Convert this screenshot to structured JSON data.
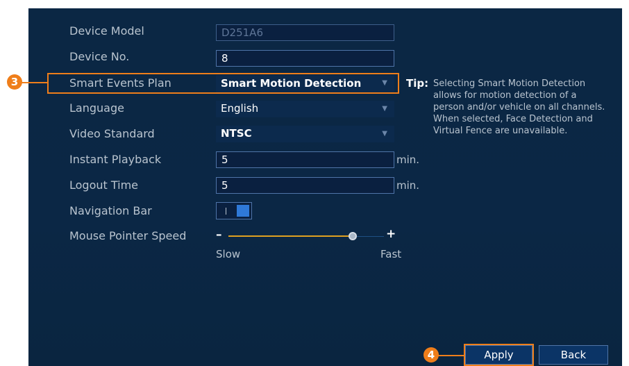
{
  "settings": {
    "device_model": {
      "label": "Device Model",
      "value": "D251A6"
    },
    "device_no": {
      "label": "Device No.",
      "value": "8"
    },
    "smart_events_plan": {
      "label": "Smart Events Plan",
      "value": "Smart Motion Detection"
    },
    "language": {
      "label": "Language",
      "value": "English"
    },
    "video_standard": {
      "label": "Video Standard",
      "value": "NTSC"
    },
    "instant_playback": {
      "label": "Instant Playback",
      "value": "5",
      "unit": "min."
    },
    "logout_time": {
      "label": "Logout Time",
      "value": "5",
      "unit": "min."
    },
    "navigation_bar": {
      "label": "Navigation Bar",
      "enabled": true
    },
    "mouse_pointer_speed": {
      "label": "Mouse Pointer Speed",
      "minus": "–",
      "plus": "+",
      "min_label": "Slow",
      "max_label": "Fast",
      "level_fraction": 0.8
    }
  },
  "tip": {
    "title": "Tip:",
    "body": "Selecting Smart Motion Detection allows for motion detection of a person and/or vehicle on all channels. When selected, Face Detection and Virtual Fence are unavailable."
  },
  "callouts": {
    "smart_events": "3",
    "apply": "4"
  },
  "buttons": {
    "apply": "Apply",
    "back": "Back"
  },
  "colors": {
    "background": "#0b2744",
    "accent": "#ef7e1a",
    "toggle_on": "#2f79d8",
    "slider": "#e0a020"
  }
}
